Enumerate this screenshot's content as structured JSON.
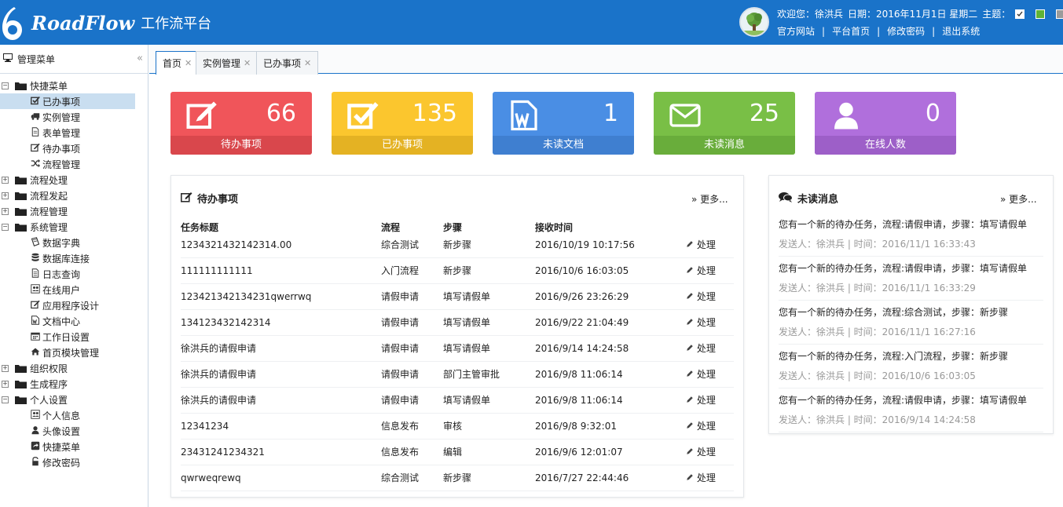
{
  "header": {
    "brand": "RoadFlow",
    "brand_sub": "工作流平台",
    "welcome": "欢迎您：徐洪兵",
    "date": "日期：2016年11月1日 星期二",
    "theme_label": "主题：",
    "links": [
      "官方网站",
      "平台首页",
      "修改密码",
      "退出系统"
    ],
    "theme_colors": [
      "#1a73c9",
      "#5fb336",
      "#9b9b9b"
    ]
  },
  "sidebar": {
    "title": "管理菜单",
    "tree": [
      {
        "label": "快捷菜单",
        "expanded": true,
        "children": [
          {
            "label": "已办事项",
            "icon": "check-square-icon",
            "active": true
          },
          {
            "label": "实例管理",
            "icon": "truck-icon"
          },
          {
            "label": "表单管理",
            "icon": "file-icon"
          },
          {
            "label": "待办事项",
            "icon": "edit-icon"
          },
          {
            "label": "流程管理",
            "icon": "random-icon"
          }
        ]
      },
      {
        "label": "流程处理",
        "expanded": false
      },
      {
        "label": "流程发起",
        "expanded": false
      },
      {
        "label": "流程管理",
        "expanded": false
      },
      {
        "label": "系统管理",
        "expanded": true,
        "children": [
          {
            "label": "数据字典",
            "icon": "book-icon"
          },
          {
            "label": "数据库连接",
            "icon": "database-icon"
          },
          {
            "label": "日志查询",
            "icon": "file-text-icon"
          },
          {
            "label": "在线用户",
            "icon": "users-icon"
          },
          {
            "label": "应用程序设计",
            "icon": "edit-icon"
          },
          {
            "label": "文档中心",
            "icon": "word-file-icon"
          },
          {
            "label": "工作日设置",
            "icon": "calendar-icon"
          },
          {
            "label": "首页模块管理",
            "icon": "home-icon"
          }
        ]
      },
      {
        "label": "组织权限",
        "expanded": false
      },
      {
        "label": "生成程序",
        "expanded": false
      },
      {
        "label": "个人设置",
        "expanded": true,
        "children": [
          {
            "label": "个人信息",
            "icon": "users-icon"
          },
          {
            "label": "头像设置",
            "icon": "user-icon"
          },
          {
            "label": "快捷菜单",
            "icon": "share-icon"
          },
          {
            "label": "修改密码",
            "icon": "lock-icon"
          }
        ]
      }
    ]
  },
  "tabs": [
    {
      "label": "首页",
      "active": true
    },
    {
      "label": "实例管理",
      "active": false
    },
    {
      "label": "已办事项",
      "active": false
    }
  ],
  "stats": [
    {
      "value": "66",
      "label": "待办事项",
      "color": "#f0555a",
      "bar": "#d9474c",
      "icon": "edit-icon"
    },
    {
      "value": "135",
      "label": "已办事项",
      "color": "#fbc62e",
      "bar": "#e4b223",
      "icon": "check-square-icon"
    },
    {
      "value": "1",
      "label": "未读文档",
      "color": "#4a8ee4",
      "bar": "#3f7fd0",
      "icon": "word-file-icon"
    },
    {
      "value": "25",
      "label": "未读消息",
      "color": "#79bf46",
      "bar": "#69ad3b",
      "icon": "envelope-icon"
    },
    {
      "value": "0",
      "label": "在线人数",
      "color": "#b06fdc",
      "bar": "#9d5fc8",
      "icon": "user-icon"
    }
  ],
  "todo": {
    "title": "待办事项",
    "more": "更多...",
    "columns": [
      "任务标题",
      "流程",
      "步骤",
      "接收时间"
    ],
    "action_label": "处理",
    "rows": [
      [
        "1234321432142314.00",
        "综合测试",
        "新步骤",
        "2016/10/19 10:17:56"
      ],
      [
        "111111111111",
        "入门流程",
        "新步骤",
        "2016/10/6 16:03:05"
      ],
      [
        "123421342134231qwerrwq",
        "请假申请",
        "填写请假单",
        "2016/9/26 23:26:29"
      ],
      [
        "134123432142314",
        "请假申请",
        "填写请假单",
        "2016/9/22 21:04:49"
      ],
      [
        "徐洪兵的请假申请",
        "请假申请",
        "填写请假单",
        "2016/9/14 14:24:58"
      ],
      [
        "徐洪兵的请假申请",
        "请假申请",
        "部门主管审批",
        "2016/9/8 11:06:14"
      ],
      [
        "徐洪兵的请假申请",
        "请假申请",
        "填写请假单",
        "2016/9/8 11:06:14"
      ],
      [
        "12341234",
        "信息发布",
        "审核",
        "2016/9/8 9:32:01"
      ],
      [
        "23431241234321",
        "信息发布",
        "编辑",
        "2016/9/6 12:01:07"
      ],
      [
        "qwrweqrewq",
        "综合测试",
        "新步骤",
        "2016/7/27 22:44:46"
      ]
    ]
  },
  "messages": {
    "title": "未读消息",
    "more": "更多...",
    "items": [
      {
        "text": "您有一个新的待办任务，流程:请假申请，步骤：填写请假单",
        "meta": "发送人：徐洪兵 | 时间：2016/11/1 16:33:43"
      },
      {
        "text": "您有一个新的待办任务，流程:请假申请，步骤：填写请假单",
        "meta": "发送人：徐洪兵 | 时间：2016/11/1 16:33:29"
      },
      {
        "text": "您有一个新的待办任务，流程:综合测试，步骤：新步骤",
        "meta": "发送人：徐洪兵 | 时间：2016/11/1 16:27:16"
      },
      {
        "text": "您有一个新的待办任务，流程:入门流程，步骤：新步骤",
        "meta": "发送人：徐洪兵 | 时间：2016/10/6 16:03:05"
      },
      {
        "text": "您有一个新的待办任务，流程:请假申请，步骤：填写请假单",
        "meta": "发送人：徐洪兵 | 时间：2016/9/14 14:24:58"
      }
    ]
  }
}
